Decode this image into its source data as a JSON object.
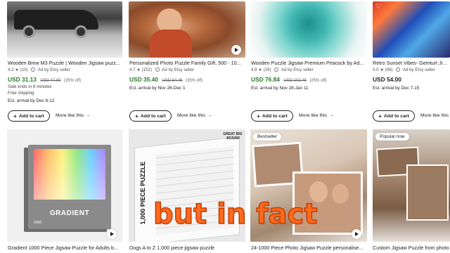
{
  "products_row1": [
    {
      "title": "Wooden Bmw M3 Puzzle | Wooden Jigsaw puzz...",
      "rating": "4.2 ★ (10)",
      "ad": "Ad by Etsy seller",
      "price": "USD 31.13",
      "orig_price": "USD 47.90",
      "discount": "(35% off)",
      "extra1": "Sale ends in 6 minutes",
      "extra2": "Free shipping",
      "arrival": "Est. arrival by Dec 6-12",
      "cart": "Add to cart",
      "more": "More like this"
    },
    {
      "title": "Personalized Photo Puzzle Family Gift, 500 - 10...",
      "rating": "4.7 ★ (152)",
      "ad": "Ad by Etsy seller",
      "price": "USD 35.40",
      "orig_price": "USD 54.46",
      "discount": "(35% off)",
      "arrival": "Est. arrival by Nov 26-Dec 1",
      "cart": "Add to cart",
      "more": "More like this"
    },
    {
      "title": "Wooden Puzzle Jigsaw Premium Peacock by Ad...",
      "rating": "4.9 ★ (26)",
      "ad": "Ad by Etsy seller",
      "price": "USD 76.84",
      "orig_price": "USD 102.45",
      "discount": "(25% off)",
      "arrival": "Est. arrival by Nov 28-Jan 11",
      "cart": "Add to cart",
      "more": "More like this"
    },
    {
      "title": "Retro Sunset Vibes- Gemturt Jigsa",
      "rating": "5.0 ★ (48)",
      "ad": "Ad by Etsy seller",
      "price": "USD 54.00",
      "arrival": "Est. arrival by Dec 7-15",
      "cart": "Add to cart",
      "more": "More like this"
    }
  ],
  "products_row2": [
    {
      "title": "Gradient 1000 Piece Jigsaw Puzzle for Adults b..."
    },
    {
      "title": "Dogs A to Z 1,000 piece jigsaw puzzle"
    },
    {
      "title": "24-1000 Piece Photo Jigsaw Puzzle personalise..."
    },
    {
      "title": "Custom Jigsaw Puzzle from photo"
    }
  ],
  "box_art": {
    "gradient_label": "GRADIENT",
    "gradient_count": "1000",
    "dogs_text": "1,000 PIECE PUZZLE",
    "dogs_brand": "GREAT BIG JIGSAW"
  },
  "badges": {
    "bestseller": "Bestseller",
    "popular": "Popular now"
  },
  "overlay_caption": "but in fact",
  "colors": {
    "price_green": "#2a7a2a",
    "caption_orange": "#ff6a1f"
  }
}
